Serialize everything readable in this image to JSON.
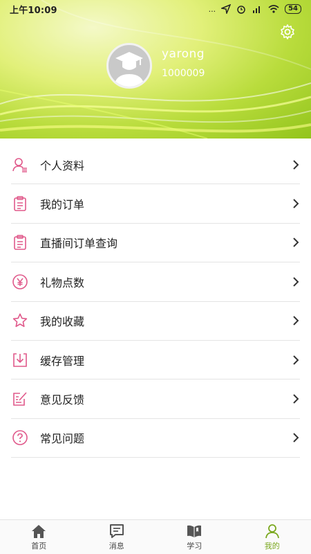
{
  "status_bar": {
    "time": "上午10:09",
    "signal_text": "...",
    "battery": "54"
  },
  "profile": {
    "username": "yarong",
    "user_id": "1000009"
  },
  "menu": {
    "items": [
      {
        "label": "个人资料",
        "icon": "user-profile-icon"
      },
      {
        "label": "我的订单",
        "icon": "clipboard-icon"
      },
      {
        "label": "直播间订单查询",
        "icon": "clipboard-icon"
      },
      {
        "label": "礼物点数",
        "icon": "yen-coin-icon"
      },
      {
        "label": "我的收藏",
        "icon": "star-icon"
      },
      {
        "label": "缓存管理",
        "icon": "download-icon"
      },
      {
        "label": "意见反馈",
        "icon": "feedback-icon"
      },
      {
        "label": "常见问题",
        "icon": "question-icon"
      }
    ]
  },
  "tabs": [
    {
      "label": "首页",
      "icon": "home-icon"
    },
    {
      "label": "消息",
      "icon": "message-icon"
    },
    {
      "label": "学习",
      "icon": "book-icon"
    },
    {
      "label": "我的",
      "icon": "user-icon",
      "active": true
    }
  ],
  "colors": {
    "accent": "#7aa81e",
    "icon_pink": "#e0588a",
    "header_green": "#a8d231"
  }
}
